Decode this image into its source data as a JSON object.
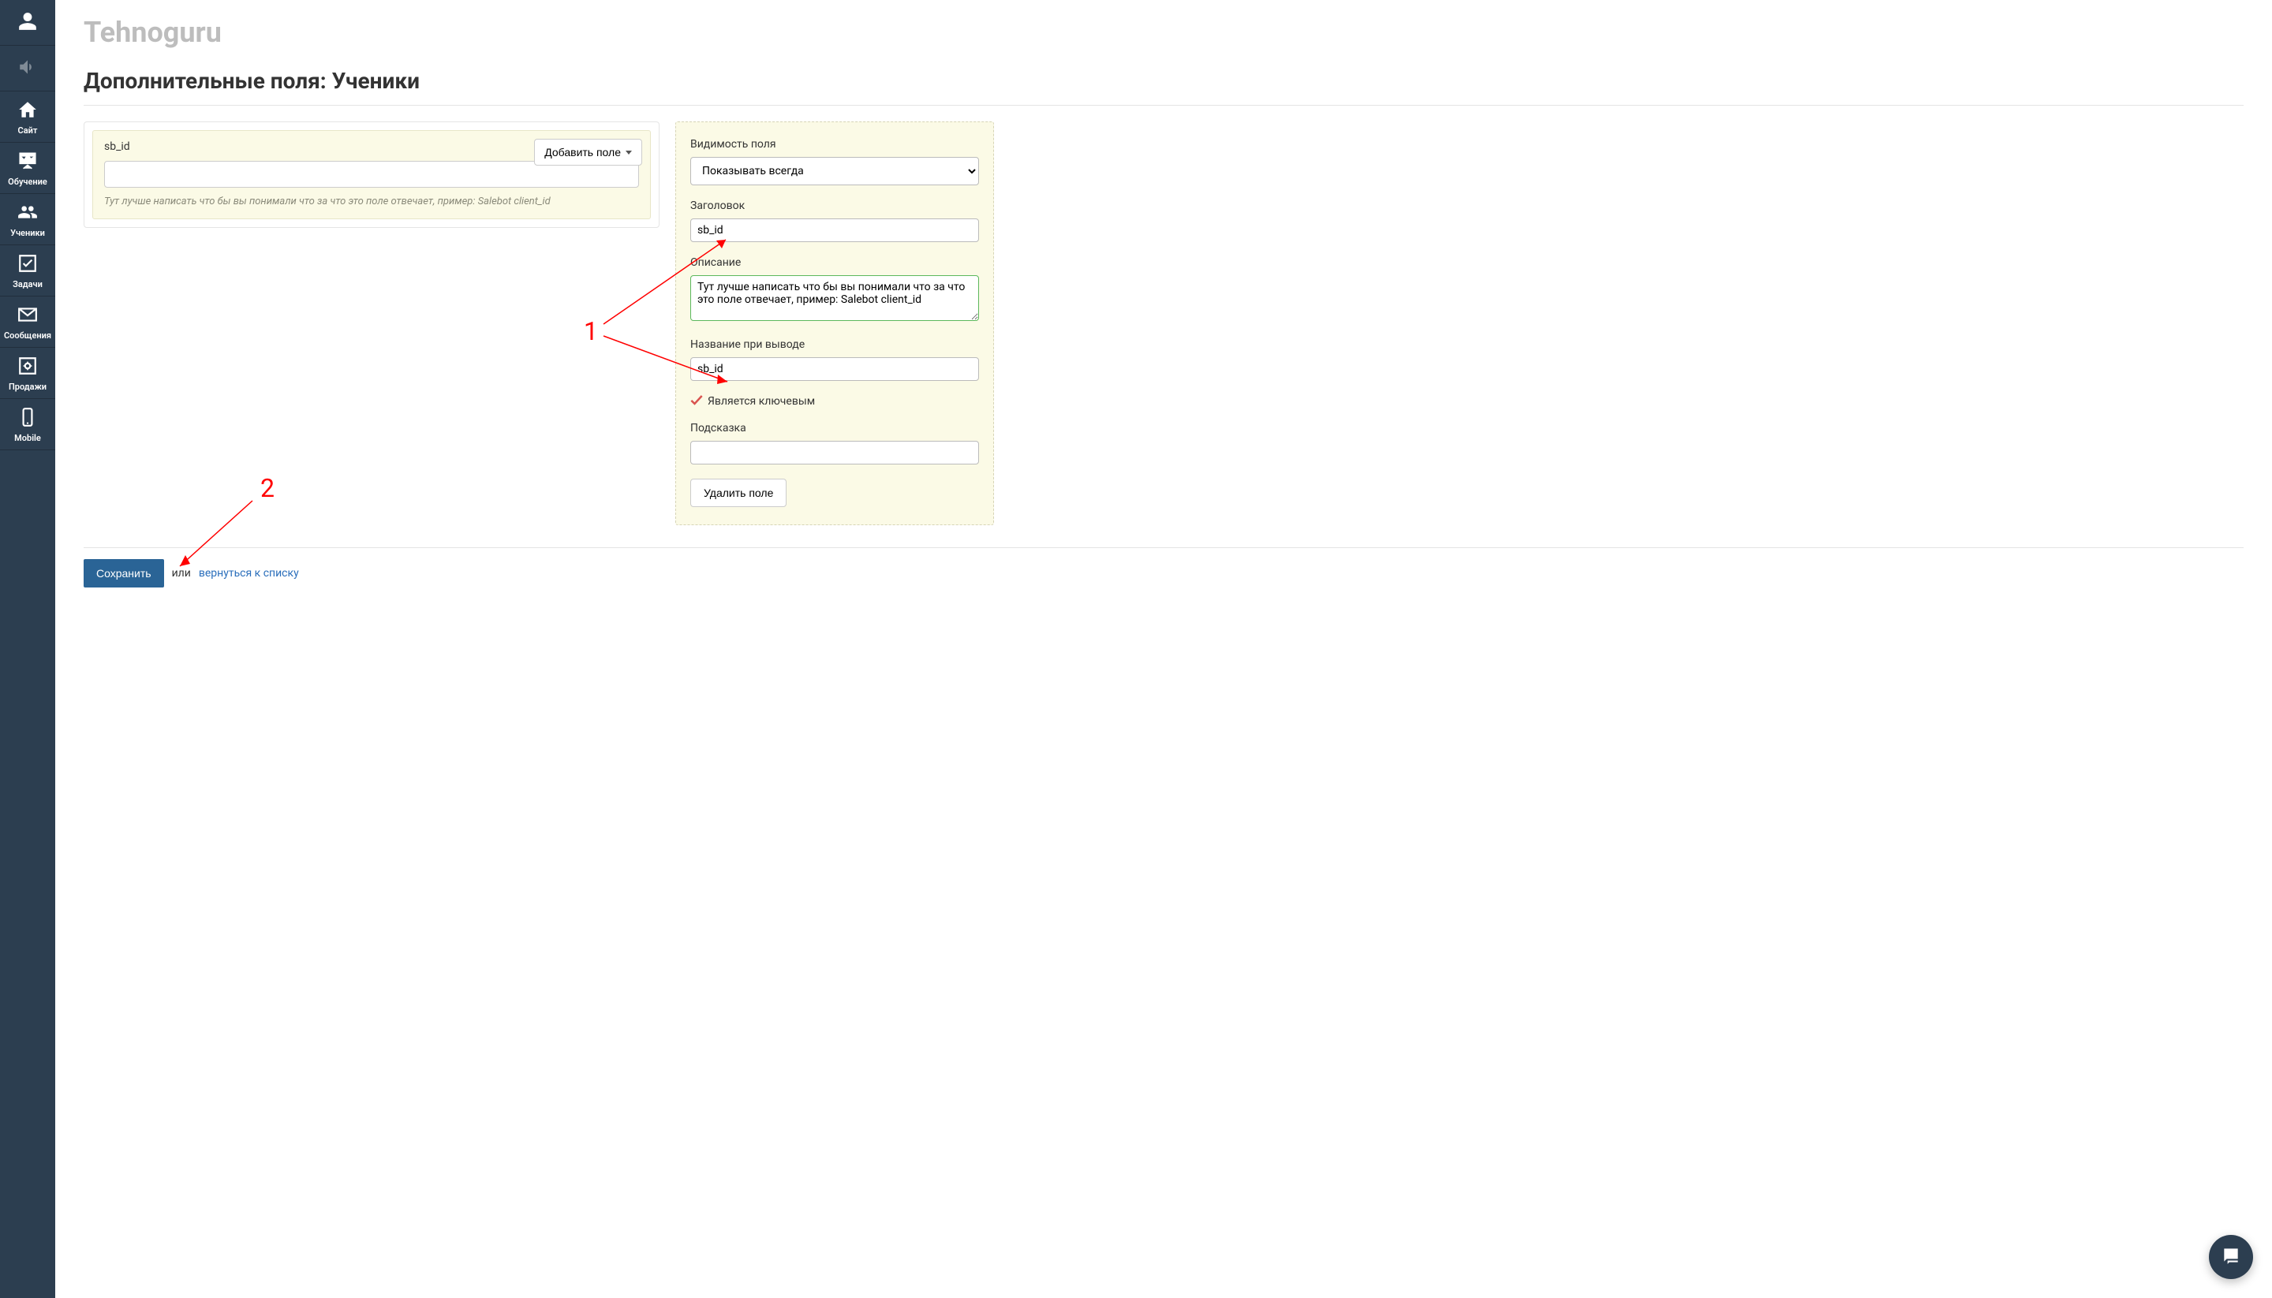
{
  "brand": "Tehnoguru",
  "page_title": "Дополнительные поля: Ученики",
  "sidebar": {
    "items": [
      {
        "name": "profile",
        "label": ""
      },
      {
        "name": "sound",
        "label": ""
      },
      {
        "name": "site",
        "label": "Сайт"
      },
      {
        "name": "training",
        "label": "Обучение"
      },
      {
        "name": "students",
        "label": "Ученики"
      },
      {
        "name": "tasks",
        "label": "Задачи"
      },
      {
        "name": "messages",
        "label": "Сообщения"
      },
      {
        "name": "sales",
        "label": "Продажи"
      },
      {
        "name": "mobile",
        "label": "Mobile"
      }
    ]
  },
  "left": {
    "field_label": "sb_id",
    "add_label": "Добавить поле",
    "value": "",
    "hint": "Тут лучше написать что бы вы понимали что за что это поле отвечает, пример: Salebot client_id"
  },
  "right": {
    "visibility_label": "Видимость поля",
    "visibility_value": "Показывать всегда",
    "title_label": "Заголовок",
    "title_value": "sb_id",
    "desc_label": "Описание",
    "desc_value": "Тут лучше написать что бы вы понимали что за что это поле отвечает, пример: Salebot client_id",
    "output_label": "Название при выводе",
    "output_value": "sb_id",
    "key_label": "Является ключевым",
    "key_checked": true,
    "hint_label": "Подсказка",
    "hint_value": "",
    "delete_label": "Удалить поле"
  },
  "footer": {
    "save": "Сохранить",
    "or": "или",
    "back": "вернуться к списку"
  },
  "annotations": {
    "one": "1",
    "two": "2"
  }
}
